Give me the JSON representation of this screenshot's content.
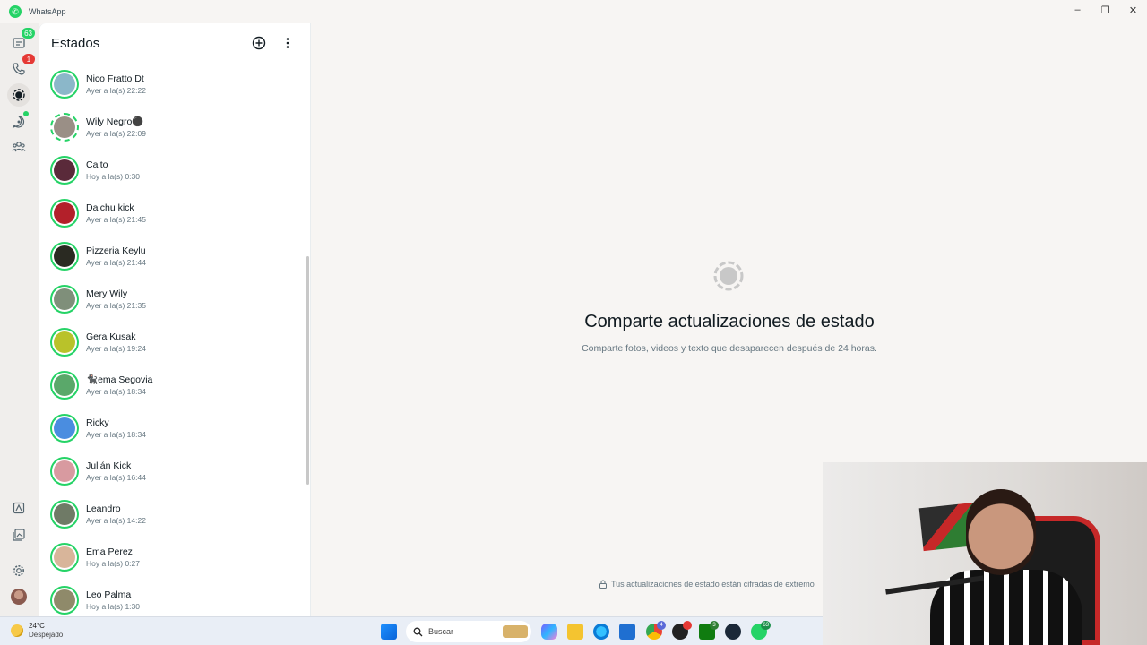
{
  "window": {
    "title": "WhatsApp",
    "controls": {
      "minimize": "–",
      "restore": "❐",
      "close": "✕"
    }
  },
  "rail": {
    "chats_badge": "63",
    "calls_badge": "1",
    "colors": {
      "badge_green": "#25d366",
      "badge_red": "#e53935"
    }
  },
  "panel": {
    "title": "Estados",
    "statuses": [
      {
        "name": "Nico Fratto Dt",
        "time": "Ayer a la(s) 22:22",
        "avatar_color": "#8bb7c9"
      },
      {
        "name": "Wily Negro⚫",
        "time": "Ayer a la(s) 22:09",
        "avatar_color": "#9a8f86"
      },
      {
        "name": "Caito",
        "time": "Hoy a la(s) 0:30",
        "avatar_color": "#5a2a3a"
      },
      {
        "name": "Daichu kick",
        "time": "Ayer a la(s) 21:45",
        "avatar_color": "#b3202a"
      },
      {
        "name": "Pizzeria Keylu",
        "time": "Ayer a la(s) 21:44",
        "avatar_color": "#2a2a22"
      },
      {
        "name": "Mery Wily",
        "time": "Ayer a la(s) 21:35",
        "avatar_color": "#7f8f7a"
      },
      {
        "name": "Gera Kusak",
        "time": "Ayer a la(s) 19:24",
        "avatar_color": "#b9c22a"
      },
      {
        "name": "🐈‍⬛ema Segovia",
        "time": "Ayer a la(s) 18:34",
        "avatar_color": "#5aa86a"
      },
      {
        "name": "Ricky",
        "time": "Ayer a la(s) 18:34",
        "avatar_color": "#4a8de0"
      },
      {
        "name": "Julián Kick",
        "time": "Ayer a la(s) 16:44",
        "avatar_color": "#d89aa0"
      },
      {
        "name": "Leandro",
        "time": "Ayer a la(s) 14:22",
        "avatar_color": "#6f7a66"
      },
      {
        "name": "Ema Perez",
        "time": "Hoy a la(s) 0:27",
        "avatar_color": "#d8b59a"
      },
      {
        "name": "Leo Palma",
        "time": "Hoy a la(s) 1:30",
        "avatar_color": "#8f8a6a"
      }
    ]
  },
  "main": {
    "empty_title": "Comparte actualizaciones de estado",
    "empty_subtitle": "Comparte fotos, videos y texto que desaparecen después de 24 horas.",
    "encryption_note": "Tus actualizaciones de estado están cifradas de extremo"
  },
  "taskbar": {
    "weather_temp": "24°C",
    "weather_desc": "Despejado",
    "search_label": "Buscar",
    "chrome_badge": "4",
    "xbox_badge": "3",
    "whatsapp_badge": "63"
  }
}
